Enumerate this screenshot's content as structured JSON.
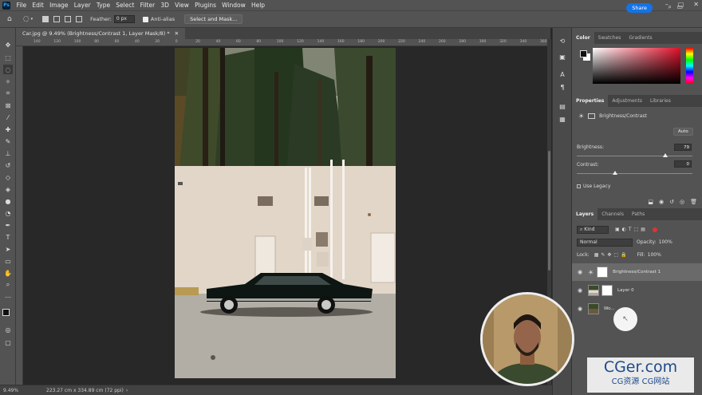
{
  "menu": [
    "File",
    "Edit",
    "Image",
    "Layer",
    "Type",
    "Select",
    "Filter",
    "3D",
    "View",
    "Plugins",
    "Window",
    "Help"
  ],
  "app_badge": "Ps",
  "options": {
    "feather_label": "Feather:",
    "feather_value": "0 px",
    "antialias_label": "Anti-alias",
    "select_mask_label": "Select and Mask..."
  },
  "share_label": "Share",
  "document_tab": "Car.jpg @ 9.49% (Brightness/Contrast 1, Layer Mask/8) *",
  "ruler_ticks": [
    "140",
    "120",
    "100",
    "80",
    "60",
    "40",
    "20",
    "0",
    "20",
    "40",
    "60",
    "80",
    "100",
    "120",
    "140",
    "160",
    "180",
    "200",
    "220",
    "240",
    "260",
    "280",
    "300",
    "320",
    "340",
    "360"
  ],
  "status": {
    "zoom": "9.49%",
    "doc_info": "223.27 cm x 334.89 cm (72 ppi)"
  },
  "color_panel": {
    "tabs": [
      "Color",
      "Swatches",
      "Gradients"
    ]
  },
  "properties_panel": {
    "tabs": [
      "Properties",
      "Adjustments",
      "Libraries"
    ],
    "title": "Brightness/Contrast",
    "auto_label": "Auto",
    "brightness_label": "Brightness:",
    "brightness_value": "79",
    "contrast_label": "Contrast:",
    "contrast_value": "0",
    "use_legacy_label": "Use Legacy"
  },
  "layers_panel": {
    "tabs": [
      "Layers",
      "Channels",
      "Paths"
    ],
    "filter_kind": "Kind",
    "blend_mode": "Normal",
    "opacity_label": "Opacity:",
    "opacity_value": "100%",
    "lock_label": "Lock:",
    "fill_label": "Fill:",
    "fill_value": "100%",
    "layers": [
      "Brightness/Contrast 1",
      "Layer 0",
      "Wo..."
    ]
  },
  "watermark": {
    "main": "CGer.com",
    "sub": "CG资源 CG网站"
  },
  "colors": {
    "accent": "#1473e6",
    "panel": "#535353",
    "canvas": "#282828"
  }
}
